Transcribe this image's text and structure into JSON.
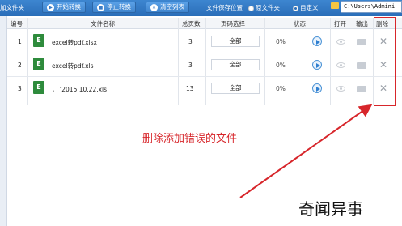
{
  "toolbar": {
    "left_cut_label": "加文件夹",
    "start_label": "开始转换",
    "stop_label": "停止转换",
    "clear_label": "清空列表",
    "save_location_label": "文件保存位置",
    "option_original_label": "原文件夹",
    "option_custom_label": "自定义",
    "path_value": "C:\\Users\\Admini"
  },
  "columns": {
    "index": "编号",
    "file_name": "文件名称",
    "total_pages": "总页数",
    "page_select": "页码选择",
    "status": "状态",
    "open": "打开",
    "output": "输出",
    "delete": "删除"
  },
  "rows": [
    {
      "index": "1",
      "file_name": "excel转pdf.xlsx",
      "pages": "3",
      "page_select": "全部",
      "progress": "0%"
    },
    {
      "index": "2",
      "file_name": "excel转pdf.xls",
      "pages": "3",
      "page_select": "全部",
      "progress": "0%"
    },
    {
      "index": "3",
      "file_name": "，                  ‘2015.10.22.xls",
      "pages": "13",
      "page_select": "全部",
      "progress": "0%"
    }
  ],
  "annotation": {
    "text": "删除添加错误的文件",
    "color": "#d7262b"
  },
  "watermark": "奇闻异事",
  "icons": {
    "file": "excel-file-icon",
    "play": "play-icon",
    "open": "eye-icon",
    "output": "folder-icon",
    "delete": "close-icon"
  }
}
